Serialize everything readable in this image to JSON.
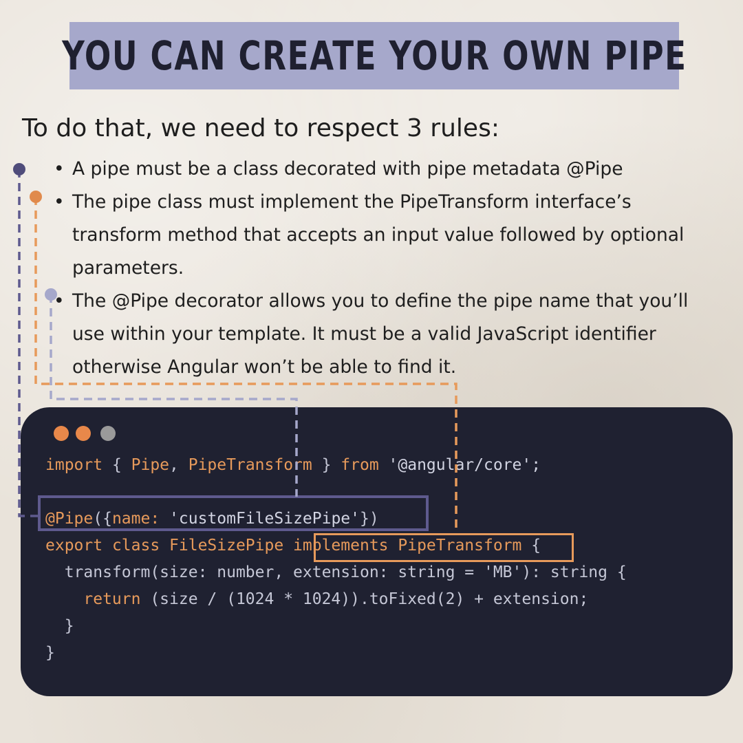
{
  "title": "YOU CAN CREATE YOUR OWN PIPE",
  "intro": "To do that, we need to respect 3 rules:",
  "rules": [
    {
      "bullet": "•",
      "text": "A pipe must be a class decorated with pipe metadata @Pipe"
    },
    {
      "bullet": "•",
      "text": "The pipe class must implement the PipeTransform interface’s transform method that accepts an input value followed by optional parameters."
    },
    {
      "bullet": "•",
      "text": "The @Pipe decorator allows you to define the pipe name that you’ll use within your template. It must be a valid JavaScript identifier otherwise Angular won’t be able to find it."
    }
  ],
  "code": {
    "import_kw": "import",
    "import_open": " { ",
    "import_pipe": "Pipe",
    "import_comma": ", ",
    "import_pipetransform": "PipeTransform",
    "import_close": " } ",
    "import_from": "from",
    "import_module": " '@angular/core';",
    "decorator_at": "@Pipe",
    "decorator_open": "({",
    "decorator_key": "name:",
    "decorator_value": " 'customFileSizePipe'",
    "decorator_close": "})",
    "export_kw": "export",
    "class_kw": " class ",
    "class_name": "FileSizePipe ",
    "implements_kw": "implements",
    "implements_type": " PipeTransform",
    "class_brace": " {",
    "method_indent": "  ",
    "method_sig": "transform(size: number, extension: string = 'MB'): string {",
    "return_indent": "    ",
    "return_kw": "return",
    "return_expr": " (size / (1024 * 1024)).toFixed(2) + extension;",
    "method_close": "  }",
    "class_close": "}"
  },
  "colors": {
    "background": "#e9e3da",
    "title_banner": "#a6a8cb",
    "code_background": "#1f2131",
    "accent_orange": "#e79a5b",
    "accent_purple": "#5e5a8e",
    "accent_lavender": "#a6a8cb",
    "dot_gray": "#9a9a9a"
  }
}
